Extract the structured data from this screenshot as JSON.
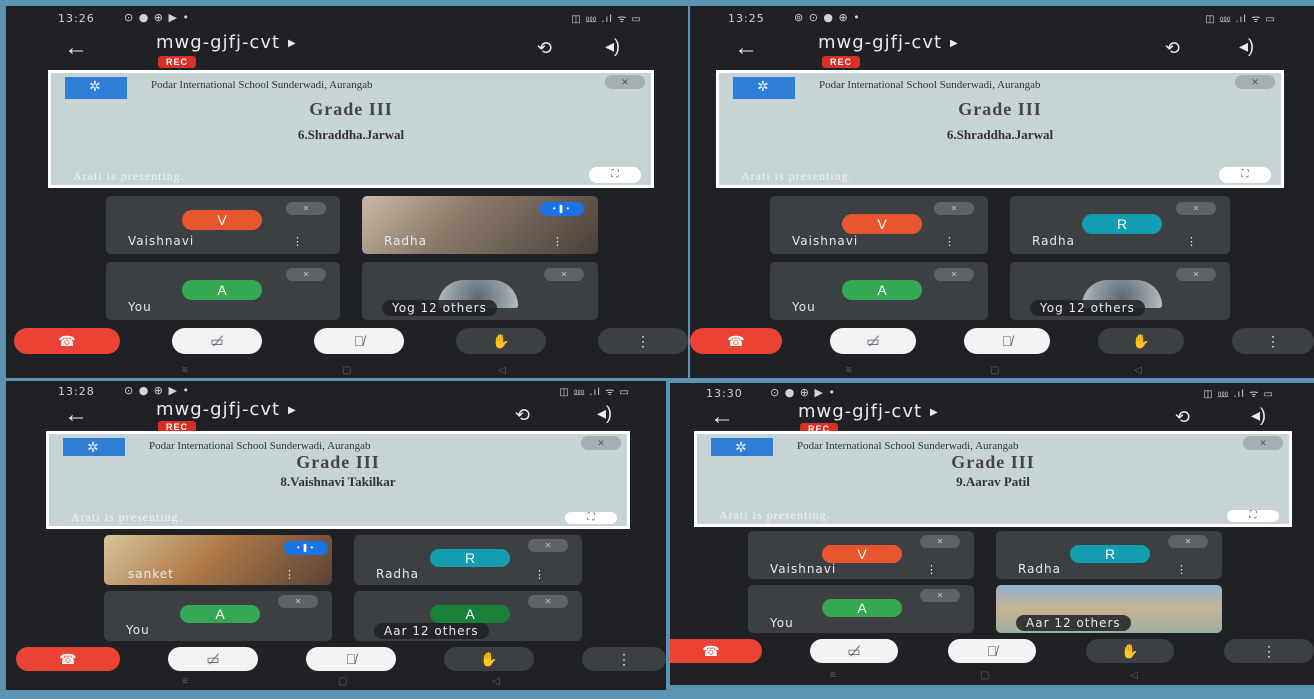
{
  "panels": [
    {
      "time": "13:26",
      "status_left": "⊙ ● ⊕ ▶ •",
      "status_right": "◫ ⅏ .ıl ᯤ ▭",
      "meeting_code": "mwg-gjfj-cvt",
      "rec_label": "REC",
      "school": "Podar International School Sunderwadi, Aurangab",
      "grade": "Grade III",
      "student": "6.Shraddha.Jarwal",
      "presenting": "Arati is presenting.",
      "tiles": [
        {
          "name": "Vaishnavi",
          "initial": "V",
          "color": "#e8562f"
        },
        {
          "name": "Radha",
          "initial": "",
          "color": ""
        },
        {
          "name": "You",
          "initial": "A",
          "color": "#34a853"
        },
        {
          "name": "Yog",
          "others": "12 others"
        }
      ]
    },
    {
      "time": "13:25",
      "status_left": "⊚ ⊙ ● ⊕ •",
      "status_right": "◫ ⅏ .ıl ᯤ ▭",
      "meeting_code": "mwg-gjfj-cvt",
      "rec_label": "REC",
      "school": "Podar International School Sunderwadi, Aurangab",
      "grade": "Grade III",
      "student": "6.Shraddha.Jarwal",
      "presenting": "Arati is presenting.",
      "tiles": [
        {
          "name": "Vaishnavi",
          "initial": "V",
          "color": "#e8562f"
        },
        {
          "name": "Radha",
          "initial": "R",
          "color": "#129eaf"
        },
        {
          "name": "You",
          "initial": "A",
          "color": "#34a853"
        },
        {
          "name": "Yog",
          "others": "12 others"
        }
      ]
    },
    {
      "time": "13:28",
      "status_left": "⊙ ● ⊕ ▶ •",
      "status_right": "◫ ⅏ .ıl ᯤ ▭",
      "meeting_code": "mwg-gjfj-cvt",
      "rec_label": "REC",
      "school": "Podar International School Sunderwadi, Aurangab",
      "grade": "Grade III",
      "student": "8.Vaishnavi Takilkar",
      "presenting": "Arati is presenting.",
      "tiles": [
        {
          "name": "sanket",
          "initial": "",
          "color": ""
        },
        {
          "name": "Radha",
          "initial": "R",
          "color": "#129eaf"
        },
        {
          "name": "You",
          "initial": "A",
          "color": "#34a853"
        },
        {
          "name": "Aar",
          "initial": "A",
          "color": "#188038",
          "others": "12 others"
        }
      ]
    },
    {
      "time": "13:30",
      "status_left": "⊙ ● ⊕ ▶ •",
      "status_right": "◫ ⅏ .ıl ᯤ ▭",
      "meeting_code": "mwg-gjfj-cvt",
      "rec_label": "REC",
      "school": "Podar International School Sunderwadi, Aurangab",
      "grade": "Grade III",
      "student": "9.Aarav Patil",
      "presenting": "Arati is presenting.",
      "tiles": [
        {
          "name": "Vaishnavi",
          "initial": "V",
          "color": "#e8562f"
        },
        {
          "name": "Radha",
          "initial": "R",
          "color": "#129eaf"
        },
        {
          "name": "You",
          "initial": "A",
          "color": "#34a853"
        },
        {
          "name": "Aar",
          "initial": "",
          "color": "",
          "others": "12 others"
        }
      ]
    }
  ],
  "icons": {
    "back": "←",
    "caret": "▶",
    "camera_switch": "⟲",
    "audio": "◂)",
    "end_call": "☎",
    "camera_off": "▭̸",
    "mic_off": "🎙̸",
    "hand": "✋",
    "more": "⋮",
    "expand": "⛶",
    "nav_back": "◁",
    "nav_home": "▢",
    "nav_recent": "≡"
  }
}
